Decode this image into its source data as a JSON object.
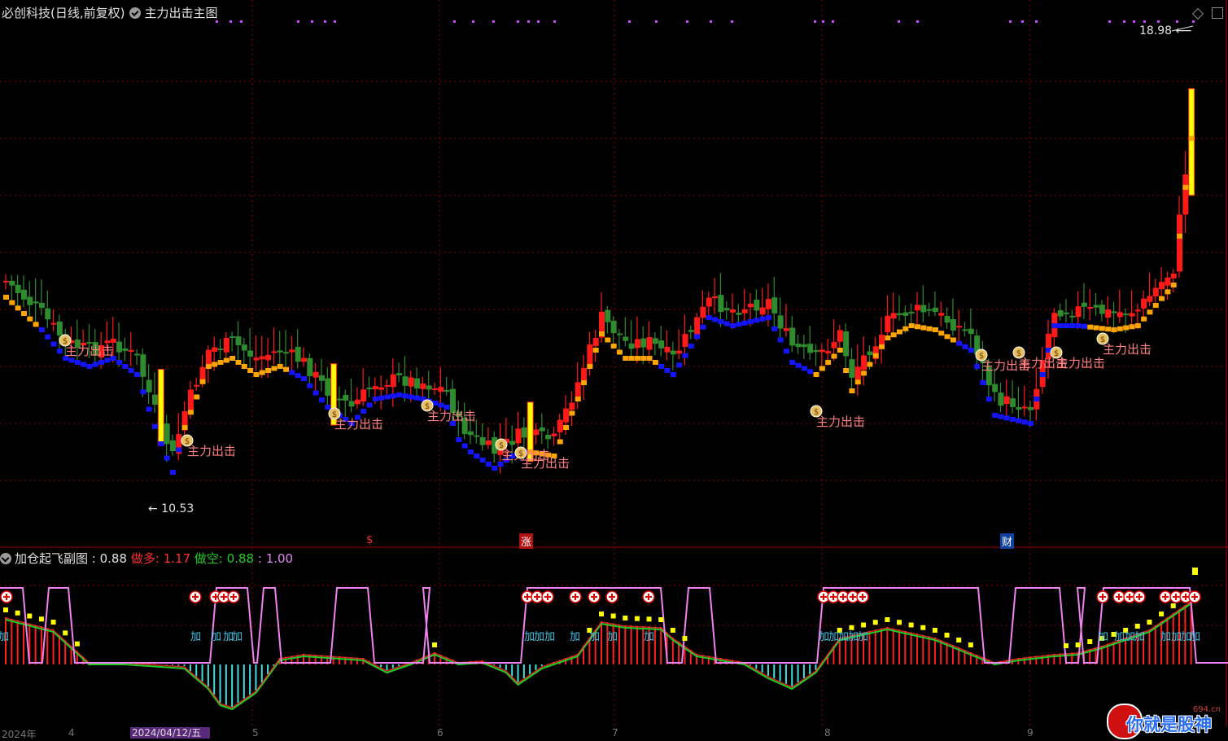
{
  "main_chart": {
    "title": "必创科技(日线,前复权)",
    "indicator_name": "主力出击主图",
    "price_high_label": "18.98",
    "price_low_label": "10.53",
    "signal_label": "主力出击",
    "event_markers": [
      "$",
      "涨",
      "财"
    ]
  },
  "sub_chart": {
    "title": "加仓起飞副图",
    "value": ": 0.88",
    "long_label": "做多",
    "long_value": ": 1.17",
    "short_label": "做空",
    "short_value": ": 0.88",
    "level_value": ": 1.00",
    "add_label": "加"
  },
  "date_axis": {
    "year_label": "2024年",
    "highlight_date": "2024/04/12/五",
    "month_ticks": [
      "4",
      "5",
      "6",
      "7",
      "8",
      "9"
    ]
  },
  "watermark": {
    "text": "你就是股神",
    "url": "694.cn"
  },
  "colors": {
    "up": "#ff1a1a",
    "down": "#2e8b2e",
    "bull_line": "#ffa500",
    "bear_line": "#1414ff",
    "surge": "#ffff00",
    "hist_up": "#ff2020",
    "hist_down": "#40e0e0",
    "fast_line": "#22cc22",
    "slow_line": "#ff3030",
    "pink_line": "#ee82ee",
    "yellow_sq": "#ffff00",
    "grid": "#8b0000",
    "divider": "#aa0000"
  },
  "chart_data": {
    "type": "candlestick",
    "title": "必创科技(日线,前复权)",
    "period": "daily",
    "ylim": [
      10.53,
      18.98
    ],
    "annotations": [
      {
        "label": "18.98",
        "type": "high"
      },
      {
        "label": "10.53",
        "type": "low"
      }
    ],
    "sub_indicator": {
      "name": "加仓起飞副图",
      "做多": 1.17,
      "做空": 0.88,
      "value": 0.88,
      "level": 1.0
    }
  }
}
